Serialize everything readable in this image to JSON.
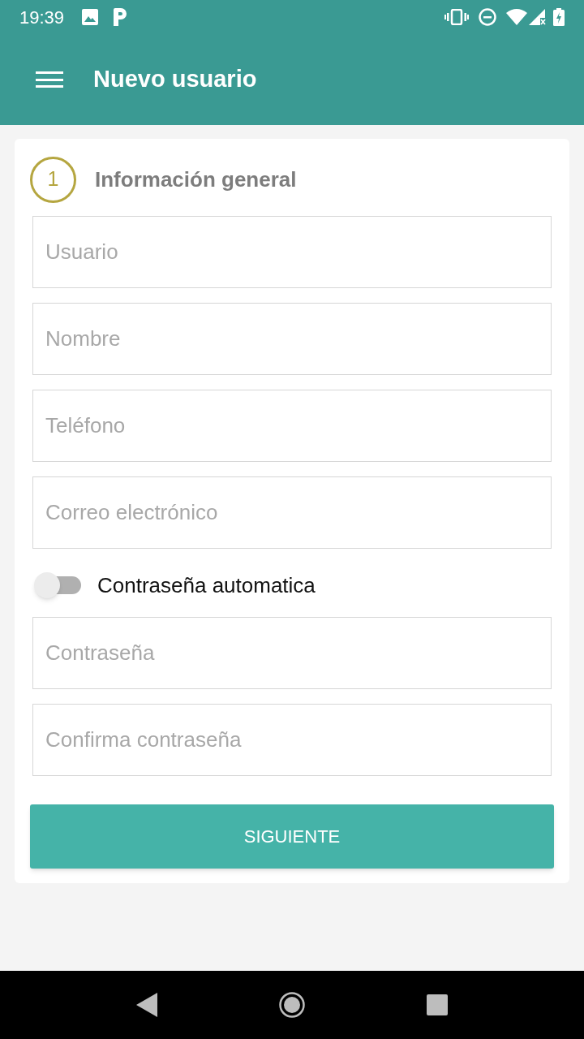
{
  "status_bar": {
    "time": "19:39"
  },
  "app_bar": {
    "title": "Nuevo usuario"
  },
  "step": {
    "number": "1",
    "title": "Información general"
  },
  "form_items": [
    {
      "kind": "field",
      "placeholder": "Usuario"
    },
    {
      "kind": "field",
      "placeholder": "Nombre"
    },
    {
      "kind": "field",
      "placeholder": "Teléfono"
    },
    {
      "kind": "field",
      "placeholder": "Correo electrónico"
    },
    {
      "kind": "toggle",
      "label": "Contraseña automatica",
      "on": false
    },
    {
      "kind": "field",
      "placeholder": "Contraseña"
    },
    {
      "kind": "field",
      "placeholder": "Confirma contraseña"
    }
  ],
  "button": {
    "label": "SIGUIENTE"
  }
}
